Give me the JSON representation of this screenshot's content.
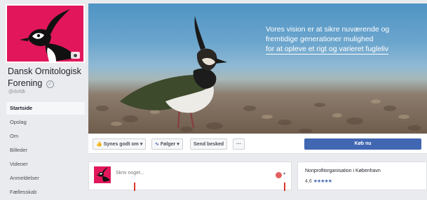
{
  "page": {
    "name": "Dansk Ornitologisk Forening",
    "handle": "@dofdk",
    "verified_glyph": "✓"
  },
  "sidebar": {
    "items": [
      {
        "label": "Startside",
        "active": true
      },
      {
        "label": "Opslag"
      },
      {
        "label": "Om"
      },
      {
        "label": "Billeder"
      },
      {
        "label": "Videoer"
      },
      {
        "label": "Anmeldelser"
      },
      {
        "label": "Fællesskab"
      }
    ]
  },
  "cover": {
    "text_lines": [
      "Vores vision er at sikre nuværende og",
      "fremtidige generationer mulighed",
      "for at opleve et rigt og varieret fugleliv"
    ]
  },
  "actions": {
    "like_label": "Synes godt om",
    "follow_label": "Følger",
    "message_label": "Send besked",
    "more_label": "···",
    "buy_label": "Køb nu"
  },
  "composer": {
    "placeholder": "Skriv noget..."
  },
  "about": {
    "category": "Nonprofitorganisation i København",
    "rating": "4,6",
    "stars": "★★★★★"
  },
  "colors": {
    "brand_pink": "#e2175b",
    "facebook_blue": "#4267b2"
  },
  "icons": [
    "camera-icon",
    "like-icon",
    "rss-icon",
    "caret-down-icon",
    "emoji-icon",
    "verified-icon"
  ]
}
